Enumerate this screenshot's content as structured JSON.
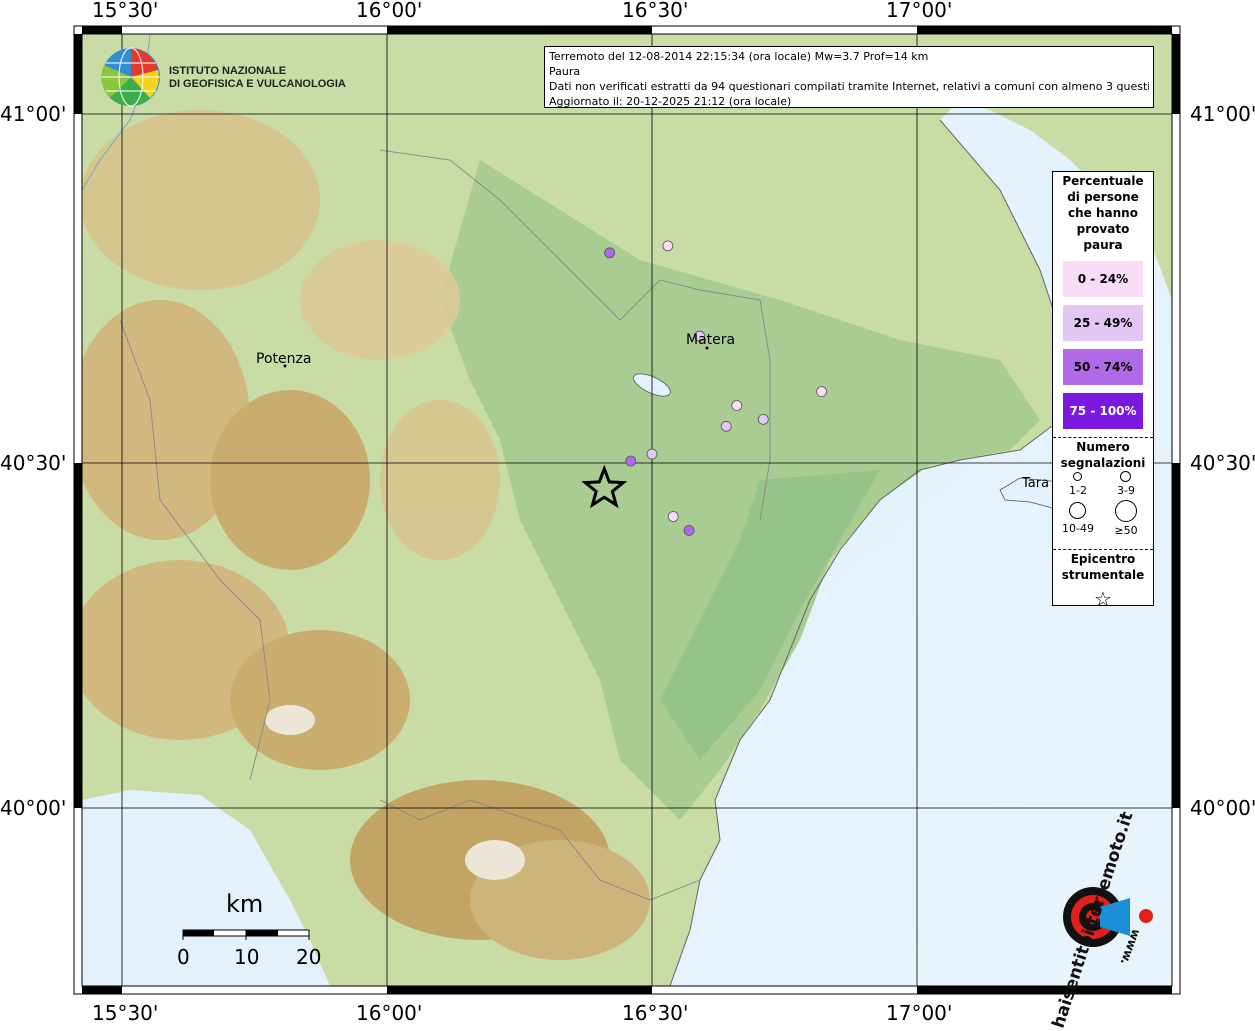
{
  "info": {
    "line1": "Terremoto del 12-08-2014 22:15:34 (ora locale) Mw=3.7 Prof=14 km",
    "line2": "Paura",
    "line3": "Dati non verificati estratti da 94 questionari compilati tramite Internet, relativi a comuni con almeno 3 questionari.",
    "line4": "Aggiornato il: 20-12-2025 21:12 (ora locale)"
  },
  "logo": {
    "line1": "ISTITUTO NAZIONALE",
    "line2": "DI GEOFISICA E VULCANOLOGIA"
  },
  "coords": {
    "top": [
      "15°30'",
      "16°00'",
      "16°30'",
      "17°00'"
    ],
    "bottom": [
      "15°30'",
      "16°00'",
      "16°30'",
      "17°00'"
    ],
    "left": [
      "41°00'",
      "40°30'",
      "40°00'"
    ],
    "right": [
      "41°00'",
      "40°30'",
      "40°00'"
    ]
  },
  "cities": {
    "potenza": "Potenza",
    "matera": "Matera",
    "taranto_partial": "Tara"
  },
  "legend": {
    "title": [
      "Percentuale",
      "di persone",
      "che hanno",
      "provato",
      "paura"
    ],
    "classes": [
      {
        "label": "0 - 24%",
        "color": "#f8dcf8",
        "text": "#000000"
      },
      {
        "label": "25 - 49%",
        "color": "#e2c6f4",
        "text": "#000000"
      },
      {
        "label": "50 - 74%",
        "color": "#b06ae8",
        "text": "#000000"
      },
      {
        "label": "75 - 100%",
        "color": "#7a1ae0",
        "text": "#ffffff"
      }
    ],
    "count_title": [
      "Numero",
      "segnalazioni"
    ],
    "count_labels": [
      "1-2",
      "3-9",
      "10-49",
      "≥50"
    ],
    "epicenter_title": [
      "Epicentro",
      "strumentale"
    ]
  },
  "scale": {
    "unit": "km",
    "labels": [
      "0",
      "10",
      "20"
    ]
  },
  "brand": {
    "text": "haisentitoilterremoto.it",
    "url": "www.",
    "colors": {
      "red": "#e0201c",
      "blue": "#1a8fd8",
      "black": "#111111"
    }
  },
  "observations": [
    {
      "lon": 16.42,
      "lat": 40.8,
      "class": 2
    },
    {
      "lon": 16.53,
      "lat": 40.81,
      "class": 0
    },
    {
      "lon": 16.59,
      "lat": 40.68,
      "class": 1
    },
    {
      "lon": 16.66,
      "lat": 40.58,
      "class": 0
    },
    {
      "lon": 16.71,
      "lat": 40.56,
      "class": 1
    },
    {
      "lon": 16.82,
      "lat": 40.6,
      "class": 0
    },
    {
      "lon": 16.64,
      "lat": 40.55,
      "class": 1
    },
    {
      "lon": 16.5,
      "lat": 40.51,
      "class": 1
    },
    {
      "lon": 16.46,
      "lat": 40.5,
      "class": 2
    },
    {
      "lon": 16.54,
      "lat": 40.42,
      "class": 0
    },
    {
      "lon": 16.57,
      "lat": 40.4,
      "class": 2
    }
  ],
  "epicenter": {
    "lon": 16.41,
    "lat": 40.46
  }
}
